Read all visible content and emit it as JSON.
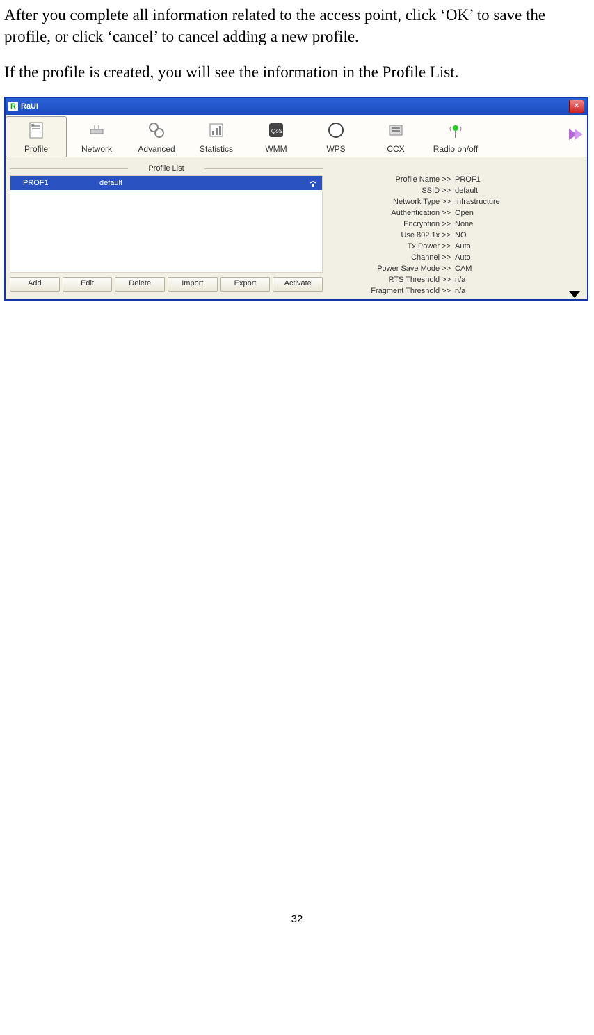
{
  "doc": {
    "para1": "After you complete all information related to the access point, click ‘OK’ to save the profile, or click ‘cancel’ to cancel adding a new profile.",
    "para2": "If the profile is created, you will see the information in the Profile List.",
    "page_number": "32"
  },
  "window": {
    "title_icon": "R",
    "title": "RaUI",
    "close": "×"
  },
  "toolbar": {
    "items": [
      {
        "label": "Profile"
      },
      {
        "label": "Network"
      },
      {
        "label": "Advanced"
      },
      {
        "label": "Statistics"
      },
      {
        "label": "WMM"
      },
      {
        "label": "WPS"
      },
      {
        "label": "CCX"
      },
      {
        "label": "Radio on/off"
      }
    ]
  },
  "profile_list": {
    "header": "Profile List",
    "rows": [
      {
        "name": "PROF1",
        "ssid": "default"
      }
    ]
  },
  "buttons": {
    "add": "Add",
    "edit": "Edit",
    "delete": "Delete",
    "import": "Import",
    "export": "Export",
    "activate": "Activate"
  },
  "details": {
    "rows": [
      {
        "label": "Profile Name >>",
        "value": "PROF1"
      },
      {
        "label": "SSID >>",
        "value": "default"
      },
      {
        "label": "Network Type >>",
        "value": "Infrastructure"
      },
      {
        "label": "Authentication >>",
        "value": "Open"
      },
      {
        "label": "Encryption >>",
        "value": "None"
      },
      {
        "label": "Use 802.1x >>",
        "value": "NO"
      },
      {
        "label": "Tx Power >>",
        "value": "Auto"
      },
      {
        "label": "Channel >>",
        "value": "Auto"
      },
      {
        "label": "Power Save Mode >>",
        "value": "CAM"
      },
      {
        "label": "RTS Threshold >>",
        "value": "n/a"
      },
      {
        "label": "Fragment Threshold >>",
        "value": "n/a"
      }
    ]
  }
}
